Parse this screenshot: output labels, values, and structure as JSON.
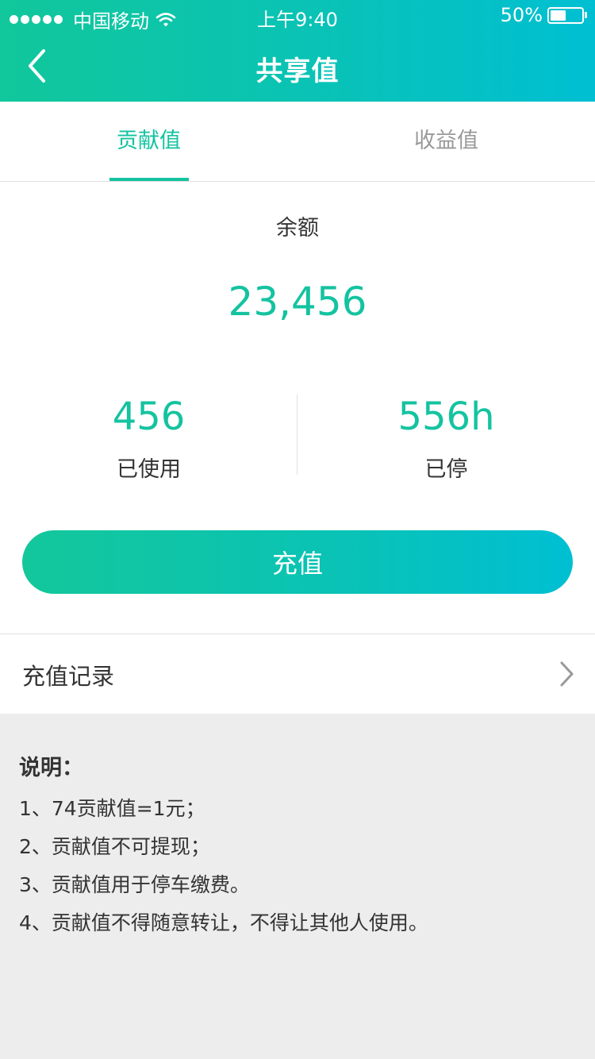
{
  "status_bar": {
    "carrier": "中国移动",
    "time": "上午9:40",
    "battery_percent": "50%",
    "battery_level": 0.5,
    "signal_dots": 5
  },
  "nav": {
    "title": "共享值",
    "back_icon": "chevron-left-icon"
  },
  "tabs": [
    {
      "label": "贡献值",
      "active": true
    },
    {
      "label": "收益值",
      "active": false
    }
  ],
  "balance": {
    "label": "余额",
    "value": "23,456"
  },
  "stats": [
    {
      "value": "456",
      "label": "已使用"
    },
    {
      "value": "556h",
      "label": "已停"
    }
  ],
  "recharge_button": {
    "label": "充值"
  },
  "record_row": {
    "label": "充值记录",
    "icon": "chevron-right-icon"
  },
  "notes": {
    "title": "说明：",
    "items": [
      "1、74贡献值=1元；",
      "2、贡献值不可提现；",
      "3、贡献值用于停车缴费。",
      "4、贡献值不得随意转让，不得让其他人使用。"
    ]
  },
  "colors": {
    "accent": "#13c3a0",
    "gradient_start": "#11c79b",
    "gradient_end": "#00bfd2",
    "background": "#ededed"
  }
}
